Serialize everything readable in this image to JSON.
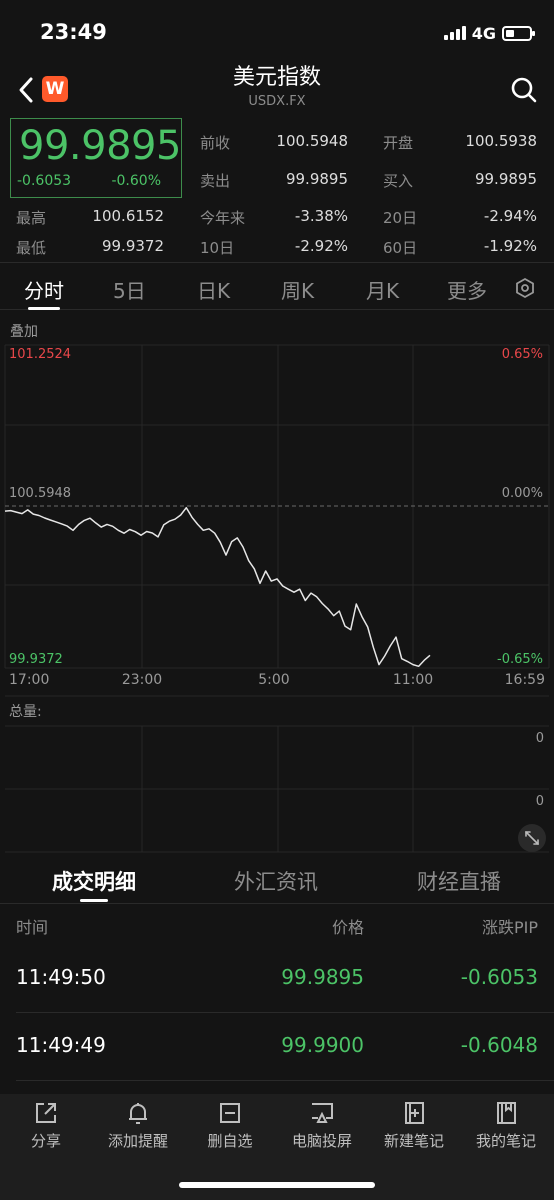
{
  "status": {
    "time": "23:49",
    "network": "4G"
  },
  "header": {
    "title": "美元指数",
    "subtitle": "USDX.FX",
    "logo": "W"
  },
  "price": {
    "last": "99.9895",
    "change": "-0.6053",
    "change_pct": "-0.60%"
  },
  "quote": {
    "prev_close_label": "前收",
    "prev_close": "100.5948",
    "open_label": "开盘",
    "open": "100.5938",
    "ask_label": "卖出",
    "ask": "99.9895",
    "bid_label": "买入",
    "bid": "99.9895",
    "high_label": "最高",
    "high": "100.6152",
    "low_label": "最低",
    "low": "99.9372",
    "ytd_label": "今年来",
    "ytd": "-3.38%",
    "d20_label": "20日",
    "d20": "-2.94%",
    "d10_label": "10日",
    "d10": "-2.92%",
    "d60_label": "60日",
    "d60": "-1.92%"
  },
  "tabs": [
    "分时",
    "5日",
    "日K",
    "周K",
    "月K",
    "更多"
  ],
  "chart": {
    "overlay_label": "叠加",
    "top_value": "101.2524",
    "top_pct": "0.65%",
    "mid_value": "100.5948",
    "mid_pct": "0.00%",
    "bottom_value": "99.9372",
    "bottom_pct": "-0.65%",
    "x_ticks": [
      "17:00",
      "23:00",
      "5:00",
      "11:00",
      "16:59"
    ],
    "volume_label": "总量:",
    "volume_top": "0",
    "volume_mid": "0"
  },
  "chart_data": {
    "type": "line",
    "ylim": [
      99.9372,
      101.2524
    ],
    "reference": 100.5948,
    "series": [
      {
        "values": [
          100.576,
          100.578,
          100.572,
          100.566,
          100.581,
          100.564,
          100.558,
          100.548,
          100.54,
          100.532,
          100.524,
          100.515,
          100.498,
          100.522,
          100.538,
          100.547,
          100.528,
          100.511,
          100.522,
          100.514,
          100.498,
          100.486,
          100.501,
          100.492,
          100.478,
          100.493,
          100.487,
          100.471,
          100.52,
          100.535,
          100.543,
          100.56,
          100.59,
          100.551,
          100.522,
          100.498,
          100.504,
          100.486,
          100.449,
          100.397,
          100.452,
          100.467,
          100.43,
          100.374,
          100.341,
          100.282,
          100.332,
          100.291,
          100.3,
          100.271,
          100.258,
          100.246,
          100.258,
          100.212,
          100.242,
          100.227,
          100.2,
          100.178,
          100.15,
          100.169,
          100.108,
          100.093,
          100.198,
          100.146,
          100.104,
          100.022,
          99.951,
          99.986,
          100.027,
          100.063,
          99.975,
          99.964,
          99.951,
          99.944,
          99.969,
          99.989
        ]
      }
    ]
  },
  "bottom_tabs": [
    "成交明细",
    "外汇资讯",
    "财经直播"
  ],
  "trades": {
    "headers": [
      "时间",
      "价格",
      "涨跌PIP"
    ],
    "rows": [
      {
        "time": "11:49:50",
        "price": "99.9895",
        "change": "-0.6053"
      },
      {
        "time": "11:49:49",
        "price": "99.9900",
        "change": "-0.6048"
      }
    ]
  },
  "toolbar": [
    "分享",
    "添加提醒",
    "删自选",
    "电脑投屏",
    "新建笔记",
    "我的笔记"
  ]
}
